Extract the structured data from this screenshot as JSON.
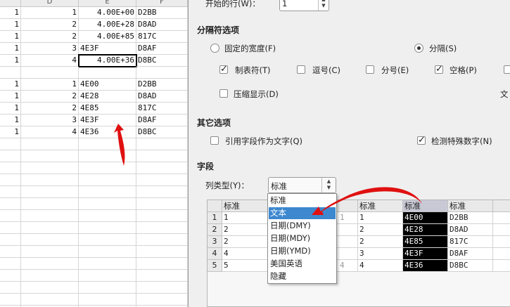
{
  "sheet": {
    "col_headers": [
      "D",
      "E",
      "F"
    ],
    "rows_top": [
      {
        "c": "1",
        "d": "1",
        "e": "4.00E+00",
        "f": "D2BB"
      },
      {
        "c": "1",
        "d": "2",
        "e": "4.00E+28",
        "f": "D8AD"
      },
      {
        "c": "1",
        "d": "2",
        "e": "4.00E+85",
        "f": "817C"
      },
      {
        "c": "1",
        "d": "3",
        "e": "4E3F",
        "f": "D8AF"
      },
      {
        "c": "1",
        "d": "4",
        "e": "4.00E+36",
        "f": "D8BC"
      }
    ],
    "rows_bottom": [
      {
        "c": "1",
        "d": "1",
        "e": "4E00",
        "f": "D2BB"
      },
      {
        "c": "1",
        "d": "2",
        "e": "4E28",
        "f": "D8AD"
      },
      {
        "c": "1",
        "d": "2",
        "e": "4E85",
        "f": "817C"
      },
      {
        "c": "1",
        "d": "3",
        "e": "4E3F",
        "f": "D8AF"
      },
      {
        "c": "1",
        "d": "4",
        "e": "4E36",
        "f": "D8BC"
      }
    ]
  },
  "dialog": {
    "start_row_label": "开始的行(W)：",
    "start_row_value": "1",
    "sep_section": "分隔符选项",
    "fixed_width": "固定的宽度(F)",
    "separated": "分隔(S)",
    "tab": "制表符(T)",
    "comma": "逗号(C)",
    "semicolon": "分号(E)",
    "space": "空格(P)",
    "merge": "压缩显示(D)",
    "text_cut": "文",
    "other_section": "其它选项",
    "quoted_as_text": "引用字段作为文字(Q)",
    "detect_numbers": "检测特殊数字(N)",
    "fields_section": "字段",
    "col_type_label": "列类型(Y)：",
    "col_type_value": "标准",
    "dropdown": [
      "标准",
      "文本",
      "日期(DMY)",
      "日期(MDY)",
      "日期(YMD)",
      "美国英语",
      "隐藏"
    ],
    "dropdown_selected": "文本",
    "preview": {
      "headers": [
        "标准",
        "标准",
        "标准",
        "标准"
      ],
      "row_numbers": [
        "1",
        "2",
        "3",
        "4",
        "5"
      ],
      "col1": [
        "1",
        "2",
        "2",
        "4",
        "5"
      ],
      "col3": [
        "1",
        "2",
        "2",
        "3",
        "4"
      ],
      "col4": [
        "4E00",
        "4E28",
        "4E85",
        "4E3F",
        "4E36"
      ],
      "col5": [
        "D2BB",
        "D8AD",
        "817C",
        "D8AF",
        "D8BC"
      ],
      "partial": [
        "1",
        "4"
      ]
    }
  },
  "colors": {
    "arrow": "#e01010",
    "highlight": "#3d88cf",
    "dialog_bg": "#efefef"
  }
}
